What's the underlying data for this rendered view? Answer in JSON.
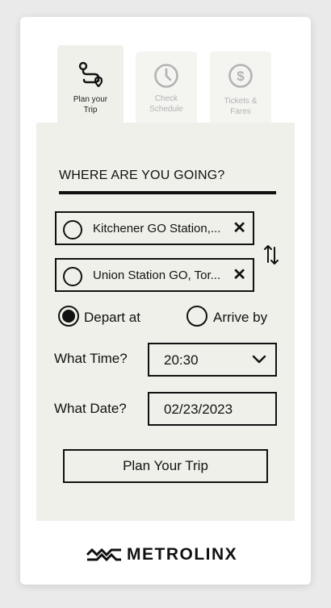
{
  "tabs": [
    {
      "label": "Plan your Trip",
      "icon": "route-icon",
      "active": true
    },
    {
      "label": "Check Schedule",
      "icon": "clock-icon",
      "active": false
    },
    {
      "label": "Tickets & Fares",
      "icon": "dollar-icon",
      "active": false
    }
  ],
  "form": {
    "heading": "WHERE ARE YOU GOING?",
    "origin": "Kitchener GO Station,...",
    "destination": "Union Station GO, Tor...",
    "clear_glyph": "✕",
    "depart_label": "Depart at",
    "arrive_label": "Arrive by",
    "selected_mode": "depart",
    "time_label": "What Time?",
    "time_value": "20:30",
    "date_label": "What Date?",
    "date_value": "02/23/2023",
    "submit_label": "Plan Your Trip"
  },
  "brand": {
    "name": "METROLINX"
  },
  "colors": {
    "panel": "#f0f0ea",
    "ink": "#111111",
    "inactive": "#b3b3b3"
  }
}
